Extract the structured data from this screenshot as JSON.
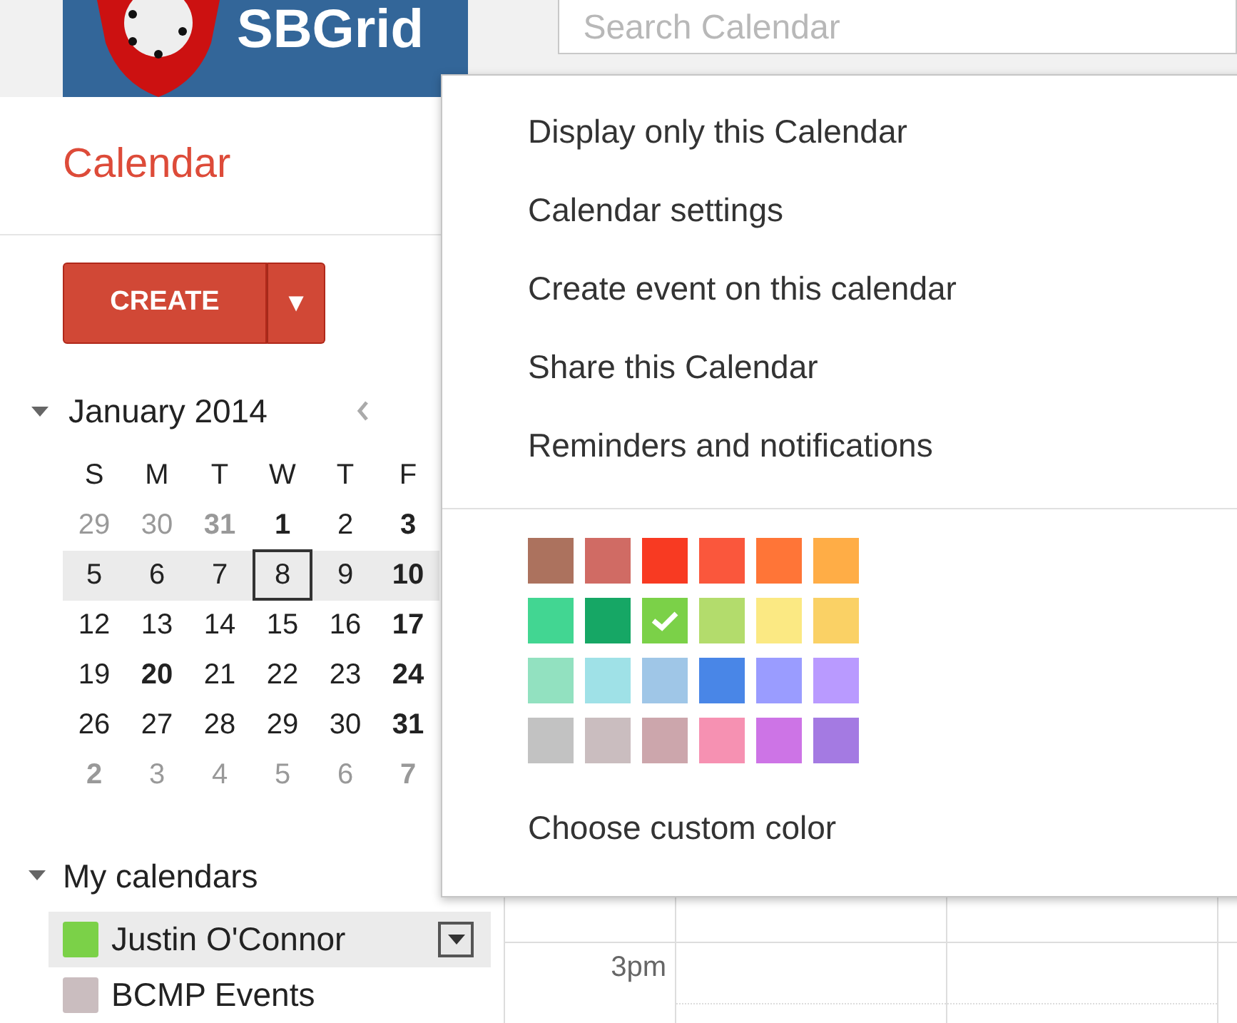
{
  "header": {
    "logo_text": "SBGrid",
    "search": {
      "placeholder": "Search Calendar"
    }
  },
  "app_title": "Calendar",
  "create_button": {
    "label": "CREATE",
    "menu_glyph": "▼"
  },
  "mini_calendar": {
    "title": "January 2014",
    "weekdays": [
      "S",
      "M",
      "T",
      "W",
      "T",
      "F"
    ],
    "weeks": [
      {
        "selected": false,
        "days": [
          {
            "label": "29",
            "bold": false,
            "muted": true,
            "today": false
          },
          {
            "label": "30",
            "bold": false,
            "muted": true,
            "today": false
          },
          {
            "label": "31",
            "bold": true,
            "muted": true,
            "today": false
          },
          {
            "label": "1",
            "bold": true,
            "muted": false,
            "today": false
          },
          {
            "label": "2",
            "bold": false,
            "muted": false,
            "today": false
          },
          {
            "label": "3",
            "bold": true,
            "muted": false,
            "today": false
          }
        ]
      },
      {
        "selected": true,
        "days": [
          {
            "label": "5",
            "bold": false,
            "muted": false,
            "today": false
          },
          {
            "label": "6",
            "bold": false,
            "muted": false,
            "today": false
          },
          {
            "label": "7",
            "bold": false,
            "muted": false,
            "today": false
          },
          {
            "label": "8",
            "bold": false,
            "muted": false,
            "today": true
          },
          {
            "label": "9",
            "bold": false,
            "muted": false,
            "today": false
          },
          {
            "label": "10",
            "bold": true,
            "muted": false,
            "today": false
          }
        ]
      },
      {
        "selected": false,
        "days": [
          {
            "label": "12",
            "bold": false,
            "muted": false,
            "today": false
          },
          {
            "label": "13",
            "bold": false,
            "muted": false,
            "today": false
          },
          {
            "label": "14",
            "bold": false,
            "muted": false,
            "today": false
          },
          {
            "label": "15",
            "bold": false,
            "muted": false,
            "today": false
          },
          {
            "label": "16",
            "bold": false,
            "muted": false,
            "today": false
          },
          {
            "label": "17",
            "bold": true,
            "muted": false,
            "today": false
          }
        ]
      },
      {
        "selected": false,
        "days": [
          {
            "label": "19",
            "bold": false,
            "muted": false,
            "today": false
          },
          {
            "label": "20",
            "bold": true,
            "muted": false,
            "today": false
          },
          {
            "label": "21",
            "bold": false,
            "muted": false,
            "today": false
          },
          {
            "label": "22",
            "bold": false,
            "muted": false,
            "today": false
          },
          {
            "label": "23",
            "bold": false,
            "muted": false,
            "today": false
          },
          {
            "label": "24",
            "bold": true,
            "muted": false,
            "today": false
          }
        ]
      },
      {
        "selected": false,
        "days": [
          {
            "label": "26",
            "bold": false,
            "muted": false,
            "today": false
          },
          {
            "label": "27",
            "bold": false,
            "muted": false,
            "today": false
          },
          {
            "label": "28",
            "bold": false,
            "muted": false,
            "today": false
          },
          {
            "label": "29",
            "bold": false,
            "muted": false,
            "today": false
          },
          {
            "label": "30",
            "bold": false,
            "muted": false,
            "today": false
          },
          {
            "label": "31",
            "bold": true,
            "muted": false,
            "today": false
          }
        ]
      },
      {
        "selected": false,
        "days": [
          {
            "label": "2",
            "bold": true,
            "muted": true,
            "today": false
          },
          {
            "label": "3",
            "bold": false,
            "muted": true,
            "today": false
          },
          {
            "label": "4",
            "bold": false,
            "muted": true,
            "today": false
          },
          {
            "label": "5",
            "bold": false,
            "muted": true,
            "today": false
          },
          {
            "label": "6",
            "bold": false,
            "muted": true,
            "today": false
          },
          {
            "label": "7",
            "bold": true,
            "muted": true,
            "today": false
          }
        ]
      }
    ]
  },
  "my_calendars": {
    "title": "My calendars",
    "items": [
      {
        "name": "Justin O'Connor",
        "color": "#7bd148",
        "selected": true
      },
      {
        "name": "BCMP Events",
        "color": "#cabdbf",
        "selected": false
      }
    ]
  },
  "grid": {
    "time_label": "3pm"
  },
  "context_menu": {
    "items": [
      "Display only this Calendar",
      "Calendar settings",
      "Create event on this calendar",
      "Share this Calendar",
      "Reminders and notifications"
    ],
    "colors": [
      {
        "color": "#ac725e",
        "selected": false
      },
      {
        "color": "#d06b64",
        "selected": false
      },
      {
        "color": "#f83a22",
        "selected": false
      },
      {
        "color": "#fa573c",
        "selected": false
      },
      {
        "color": "#ff7537",
        "selected": false
      },
      {
        "color": "#ffad46",
        "selected": false
      },
      {
        "color": "#42d692",
        "selected": false
      },
      {
        "color": "#16a765",
        "selected": false
      },
      {
        "color": "#7bd148",
        "selected": true
      },
      {
        "color": "#b3dc6c",
        "selected": false
      },
      {
        "color": "#fbe983",
        "selected": false
      },
      {
        "color": "#fad165",
        "selected": false
      },
      {
        "color": "#92e1c0",
        "selected": false
      },
      {
        "color": "#9fe1e7",
        "selected": false
      },
      {
        "color": "#9fc6e7",
        "selected": false
      },
      {
        "color": "#4986e7",
        "selected": false
      },
      {
        "color": "#9a9cff",
        "selected": false
      },
      {
        "color": "#b99aff",
        "selected": false
      },
      {
        "color": "#c2c2c2",
        "selected": false
      },
      {
        "color": "#cabdbf",
        "selected": false
      },
      {
        "color": "#cca6ac",
        "selected": false
      },
      {
        "color": "#f691b2",
        "selected": false
      },
      {
        "color": "#cd74e6",
        "selected": false
      },
      {
        "color": "#a47ae2",
        "selected": false
      }
    ],
    "custom_color": "Choose custom color"
  }
}
